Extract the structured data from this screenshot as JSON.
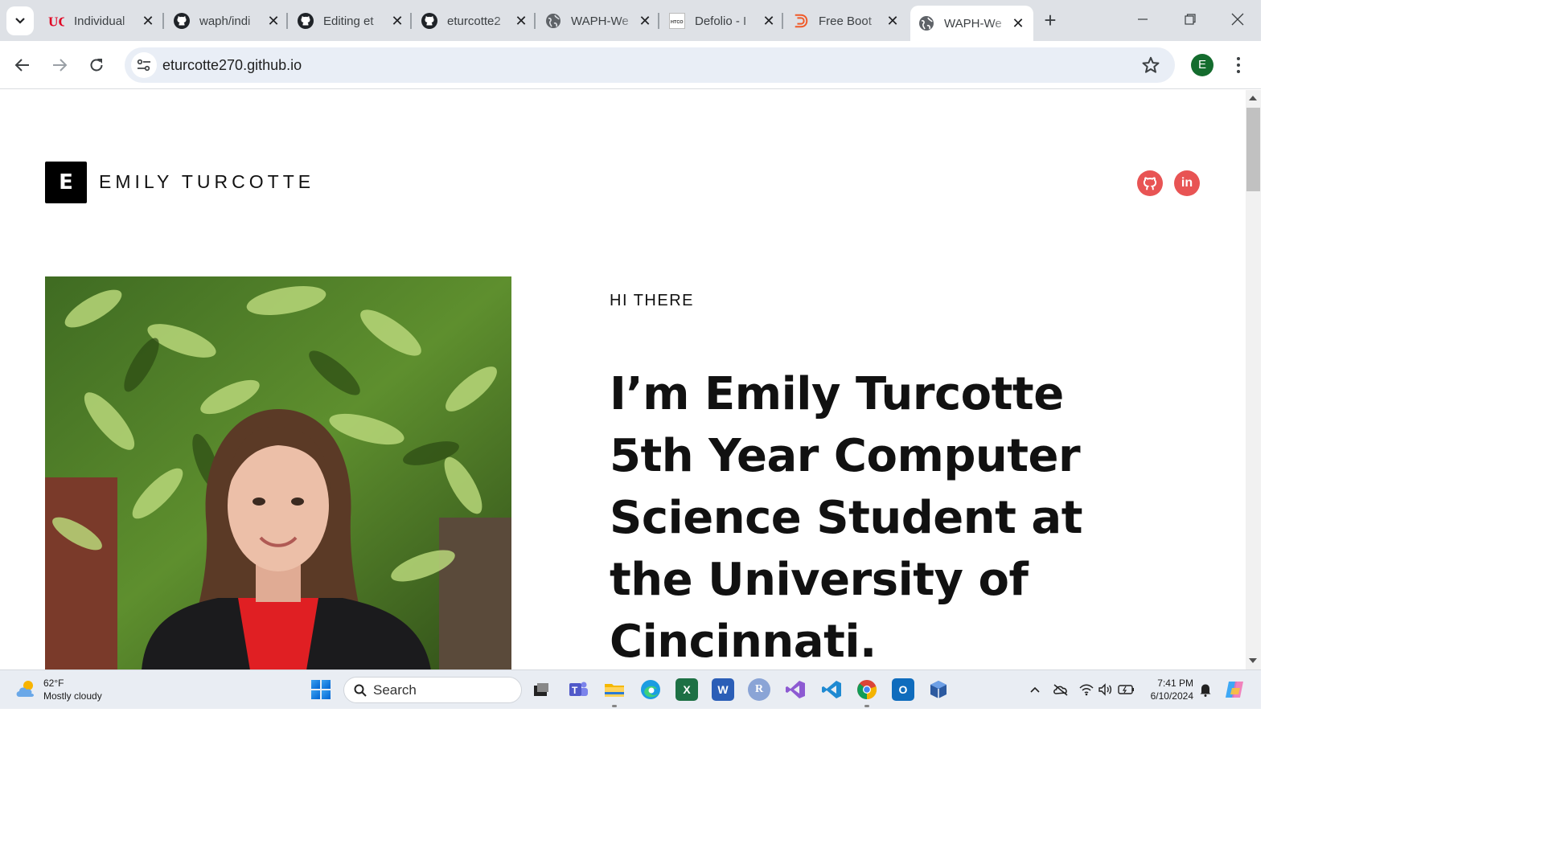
{
  "browser": {
    "tabs": [
      {
        "title": "Individual",
        "icon": "uc-logo-icon"
      },
      {
        "title": "waph/indi",
        "icon": "github-icon"
      },
      {
        "title": "Editing et",
        "icon": "github-icon"
      },
      {
        "title": "eturcotte2",
        "icon": "github-icon"
      },
      {
        "title": "WAPH-We",
        "icon": "globe-icon"
      },
      {
        "title": "Defolio - I",
        "icon": "htco-icon"
      },
      {
        "title": "Free Boot",
        "icon": "bootstrap-d-icon"
      },
      {
        "title": "WAPH-We",
        "icon": "globe-icon",
        "active": true
      }
    ],
    "url": "eturcotte270.github.io",
    "profile_initial": "E",
    "colors": {
      "profile": "#146c2e",
      "tabstrip": "#dee1e6",
      "omnibox": "#e9eef6"
    }
  },
  "page": {
    "logo_letter": "E",
    "site_name": "EMILY TURCOTTE",
    "social": [
      {
        "name": "github",
        "icon": "github-icon"
      },
      {
        "name": "linkedin",
        "icon": "linkedin-icon",
        "label": "in"
      }
    ],
    "eyebrow": "HI THERE",
    "headline": "I’m Emily Turcotte 5th Year Computer Science Student at the University of Cincinnati.",
    "accent_color": "#e85454"
  },
  "taskbar": {
    "weather": {
      "temp": "62°F",
      "condition": "Mostly cloudy"
    },
    "search_placeholder": "Search",
    "clock": {
      "time": "7:41 PM",
      "date": "6/10/2024"
    }
  }
}
